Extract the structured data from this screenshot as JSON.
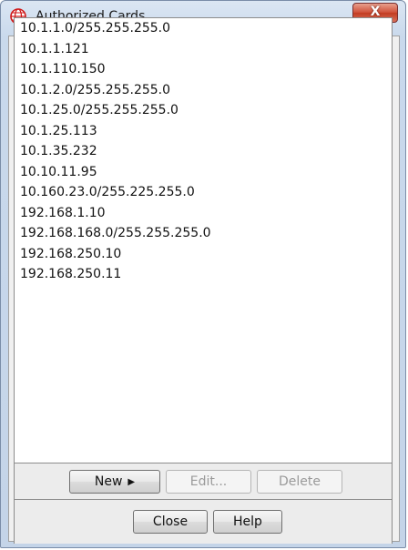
{
  "window": {
    "title": "Authorized Cards",
    "close_label": "X",
    "icon": "globe-icon"
  },
  "cards": [
    "10.1.1.0/255.255.255.0",
    "10.1.1.121",
    "10.1.110.150",
    "10.1.2.0/255.255.255.0",
    "10.1.25.0/255.255.255.0",
    "10.1.25.113",
    "10.1.35.232",
    "10.10.11.95",
    "10.160.23.0/255.225.255.0",
    "192.168.1.10",
    "192.168.168.0/255.255.255.0",
    "192.168.250.10",
    "192.168.250.11"
  ],
  "actions": {
    "new_label": "New",
    "edit_label": "Edit...",
    "delete_label": "Delete"
  },
  "footer": {
    "close_label": "Close",
    "help_label": "Help"
  },
  "colors": {
    "icon_red": "#d01818"
  }
}
